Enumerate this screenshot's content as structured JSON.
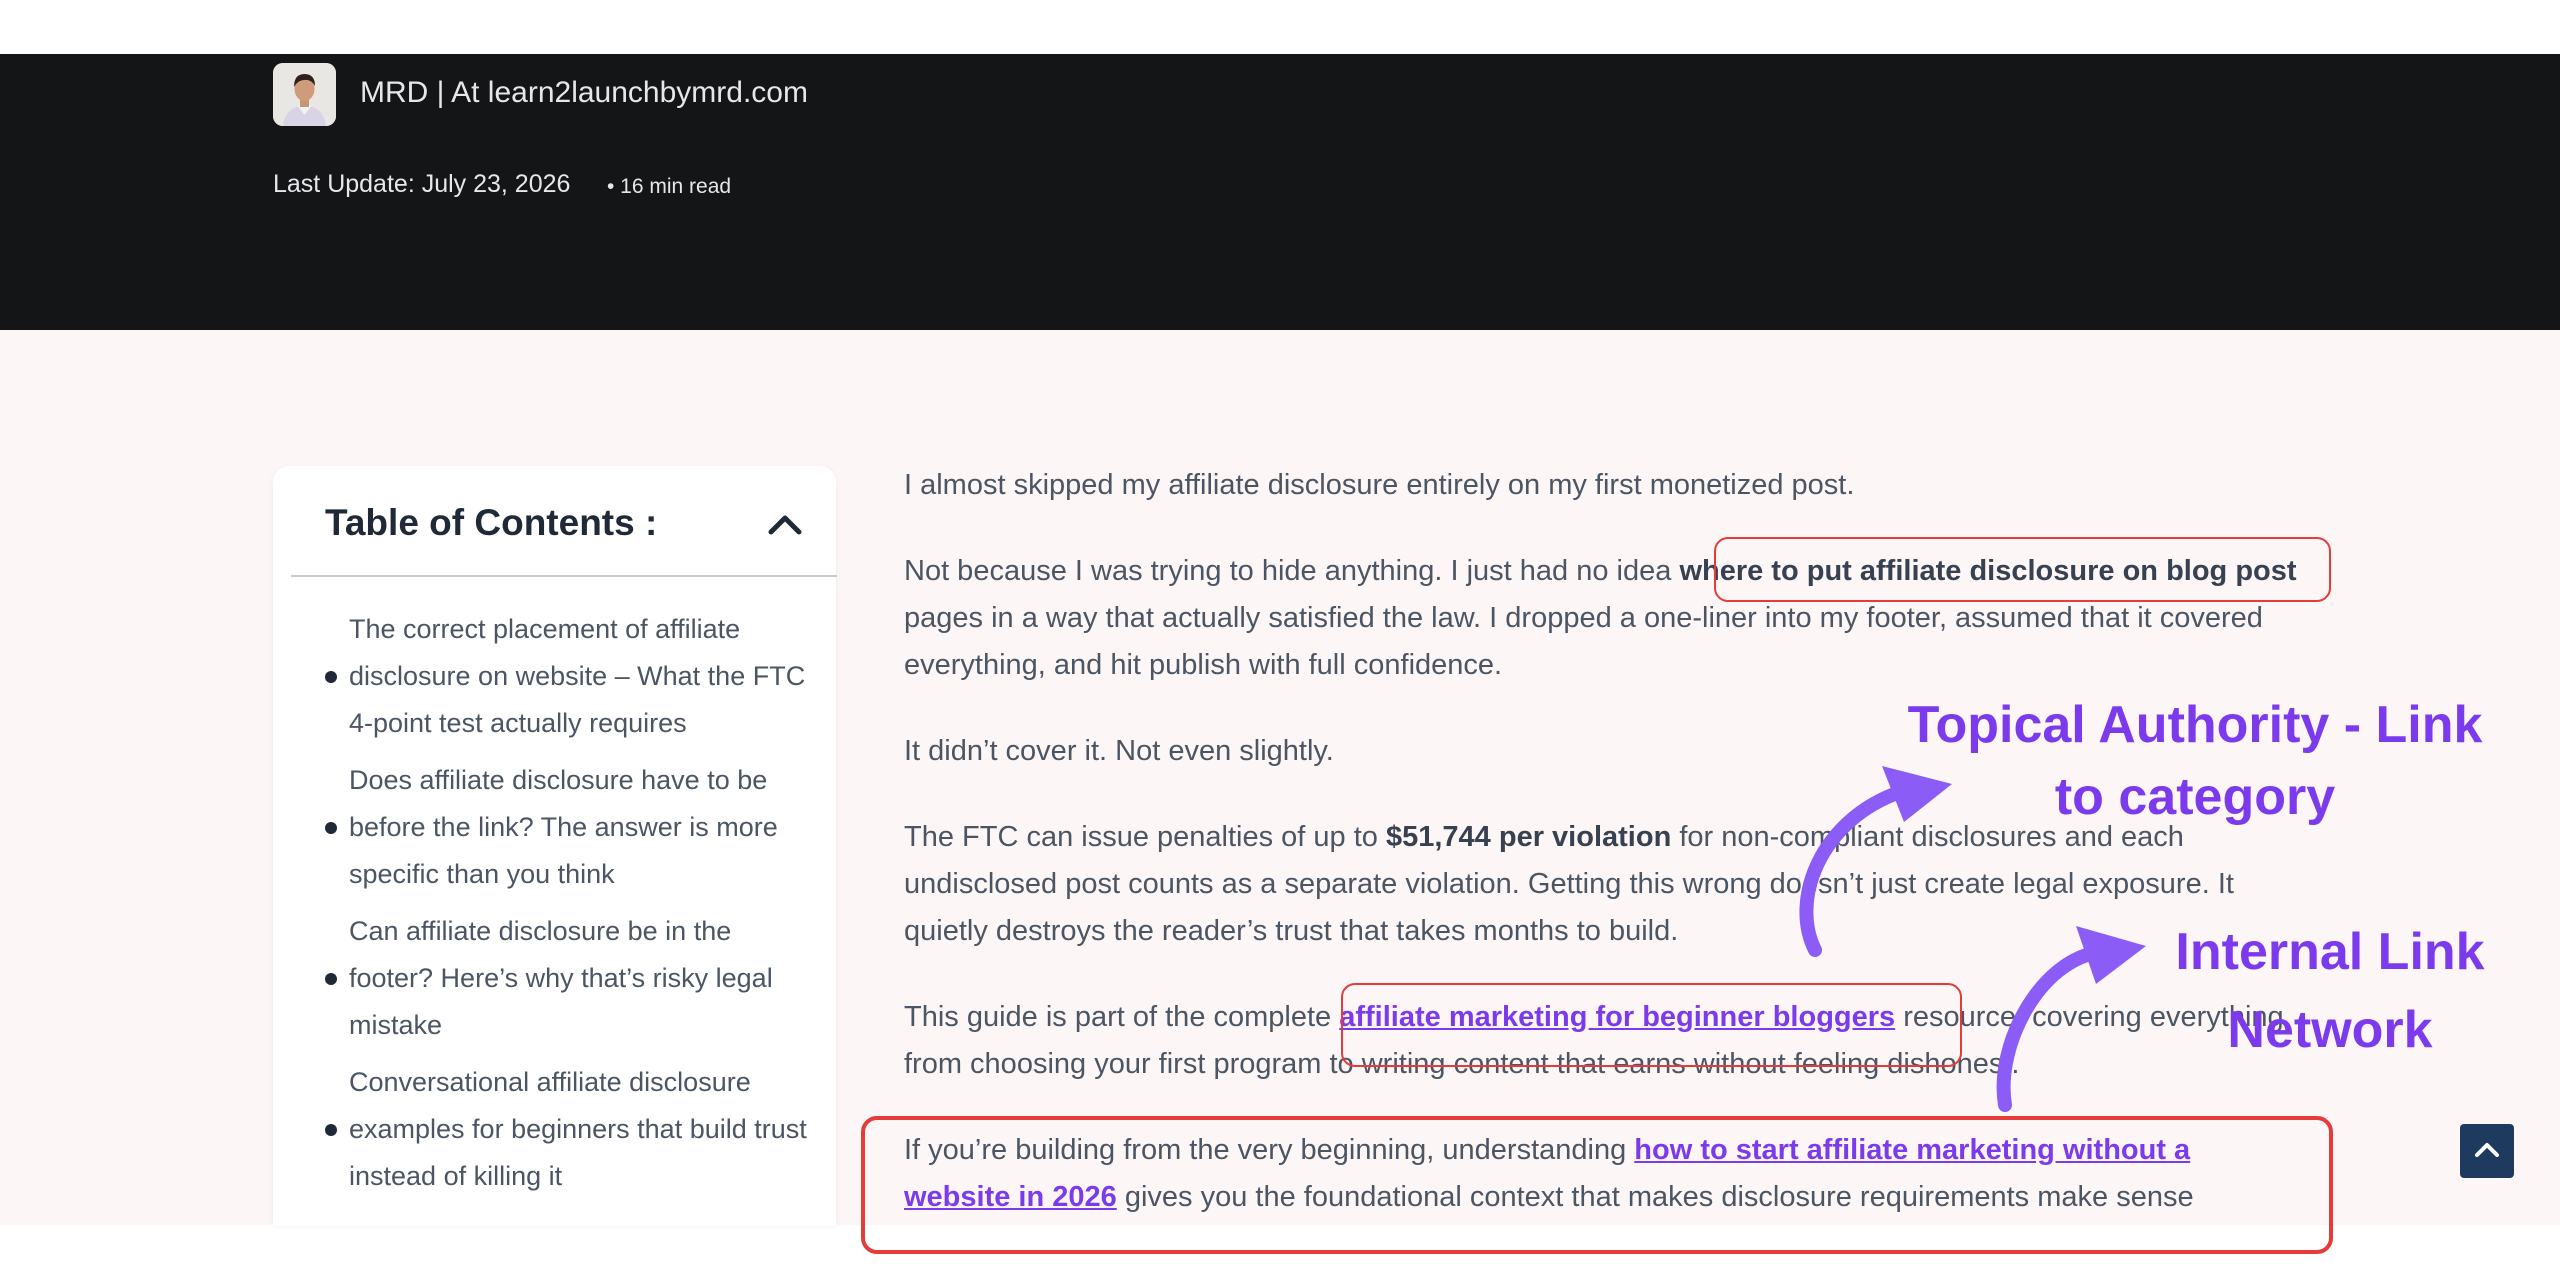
{
  "header": {
    "author": "MRD | At learn2launchbymrd.com",
    "last_update": "Last Update: July 23, 2026",
    "read_time": "• 16 min read"
  },
  "toc": {
    "title": "Table of Contents :",
    "toggle_icon": "chevron-up-icon",
    "items": [
      {
        "label": "The correct placement of affiliate disclosure on website – What the FTC 4-point test actually requires"
      },
      {
        "label": "Does affiliate disclosure have to be before the link? The answer is more specific than you think"
      },
      {
        "label": "Can affiliate disclosure be in the footer? Here’s why that’s risky legal mistake"
      },
      {
        "label": "Conversational affiliate disclosure examples for beginners that build trust instead of killing it"
      }
    ]
  },
  "article": {
    "p1": "I almost skipped my affiliate disclosure entirely on my first monetized post.",
    "p2_pre": "Not because I was trying to hide anything. I just had no idea ",
    "p2_bold": "where to put affiliate disclosure on blog post",
    "p2_post": " pages in a way that actually satisfied the law. I dropped a one-liner into my footer, assumed that it covered everything, and hit publish with full confidence.",
    "p3": "It didn’t cover it. Not even slightly.",
    "p4_pre": "The FTC can issue penalties of up to ",
    "p4_bold": "$51,744 per violation",
    "p4_post": " for non-compliant disclosures and each undisclosed post counts as a separate violation. Getting this wrong doesn’t just create legal exposure. It quietly destroys the reader’s trust that takes months to build.",
    "p5_pre": "This guide is part of the complete ",
    "p5_link": "affiliate marketing for beginner bloggers",
    "p5_post": " resource, covering everything from choosing your first program to writing content that earns without feeling dishonest.",
    "p6_pre": "If you’re building from the very beginning, understanding ",
    "p6_link": "how to start affiliate marketing without a website in 2026",
    "p6_post": " gives you the foundational context that makes disclosure requirements make sense"
  },
  "annotations": {
    "callout1": "Topical Authority - Link to category",
    "callout2": "Internal Link Network",
    "callout_color": "#7c3aed",
    "highlight_color": "#e63b3b"
  },
  "back_to_top_icon": "chevron-up-icon",
  "colors": {
    "hero_bg": "#141517",
    "content_bg": "#fdf6f6",
    "link": "#7c3aed",
    "back_to_top": "#1e3a5f"
  }
}
